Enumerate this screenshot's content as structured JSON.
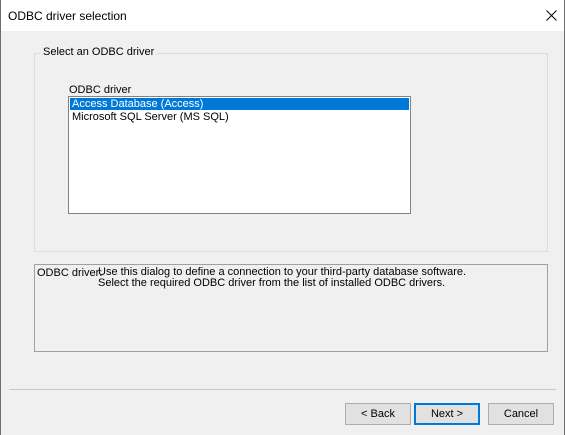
{
  "window": {
    "title": "ODBC driver selection"
  },
  "group": {
    "legend": "Select an ODBC driver",
    "field_label": "ODBC driver",
    "drivers": [
      {
        "label": "Access Database (Access)",
        "selected": true
      },
      {
        "label": "Microsoft SQL Server (MS SQL)",
        "selected": false
      }
    ]
  },
  "info": {
    "label": "ODBC driver:",
    "line1": "Use this dialog to define a connection to your third-party database software.",
    "line2": "Select the required ODBC driver from the list of installed ODBC drivers."
  },
  "buttons": {
    "back": "< Back",
    "next": "Next >",
    "cancel": "Cancel"
  },
  "icons": {
    "close": "close-icon"
  },
  "colors": {
    "selection": "#0078d7",
    "dialog_bg": "#f0f0f0"
  }
}
